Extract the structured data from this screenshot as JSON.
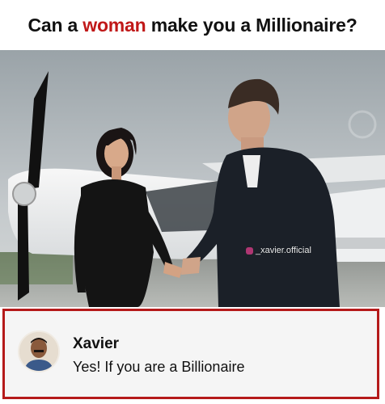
{
  "headline": {
    "before": "Can a ",
    "accent": "woman",
    "after": " make you a Millionaire?",
    "accent_color": "#c01818"
  },
  "photo": {
    "watermark": "_xavier.official",
    "watermark_icon": "instagram-icon"
  },
  "comment": {
    "author": "Xavier",
    "text": "Yes! If you are a Billionaire",
    "border_color": "#b51a1a"
  }
}
